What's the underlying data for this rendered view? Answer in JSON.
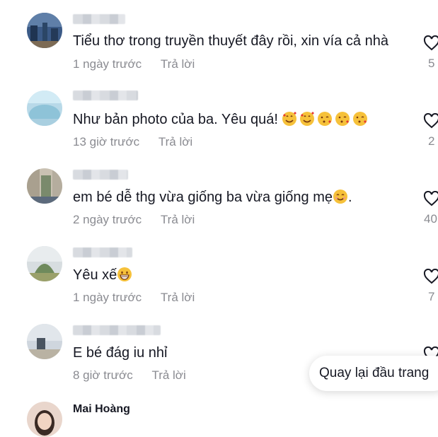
{
  "comments": [
    {
      "username": "",
      "text": "Tiểu thơ trong truyền thuyết đây rồi, xin vía cả nhà",
      "emojis": [],
      "time": "1 ngày trước",
      "reply": "Trả lời",
      "likes": "5"
    },
    {
      "username": "",
      "text": "Như bản photo của ba. Yêu quá!",
      "emojis": [
        "smiling-face-with-hearts",
        "smiling-face-with-hearts",
        "face-blowing-kiss",
        "face-blowing-kiss",
        "face-blowing-kiss"
      ],
      "time": "13 giờ trước",
      "reply": "Trả lời",
      "likes": "2"
    },
    {
      "username": "",
      "text": "em bé dễ thg vừa giống ba vừa giống mẹ",
      "text_after": ".",
      "emojis": [
        "smiling-face-with-smiling-eyes"
      ],
      "time": "2 ngày trước",
      "reply": "Trả lời",
      "likes": "40"
    },
    {
      "username": "",
      "text": "Yêu xế",
      "emojis": [
        "grinning-face"
      ],
      "time": "1 ngày trước",
      "reply": "Trả lời",
      "likes": "7"
    },
    {
      "username": "",
      "text": "E bé đág iu nhỉ",
      "emojis": [],
      "time": "8 giờ trước",
      "reply": "Trả lời",
      "likes": ""
    },
    {
      "username": "Mai Hoàng"
    }
  ],
  "back_to_top": "Quay lại đầu trang",
  "icons": {
    "like": "heart-outline-icon"
  },
  "colors": {
    "text": "#161823",
    "meta": "#8a8b91"
  }
}
